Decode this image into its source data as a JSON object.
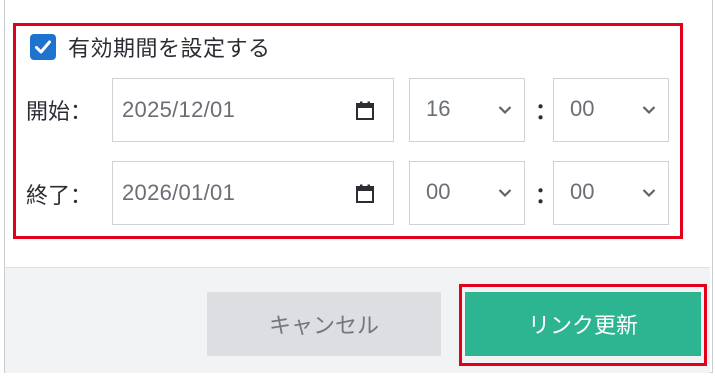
{
  "expiry": {
    "checkbox_label": "有効期間を設定する",
    "checked": true,
    "start": {
      "label": "開始",
      "date": "2025/12/01",
      "hour": "16",
      "minute": "00"
    },
    "end": {
      "label": "終了",
      "date": "2026/01/01",
      "hour": "00",
      "minute": "00"
    },
    "label_suffix": "：",
    "time_separator": "："
  },
  "footer": {
    "cancel_label": "キャンセル",
    "update_label": "リンク更新"
  },
  "colors": {
    "accent": "#1f73cf",
    "primary_button": "#2db592",
    "highlight": "#e3001b"
  }
}
